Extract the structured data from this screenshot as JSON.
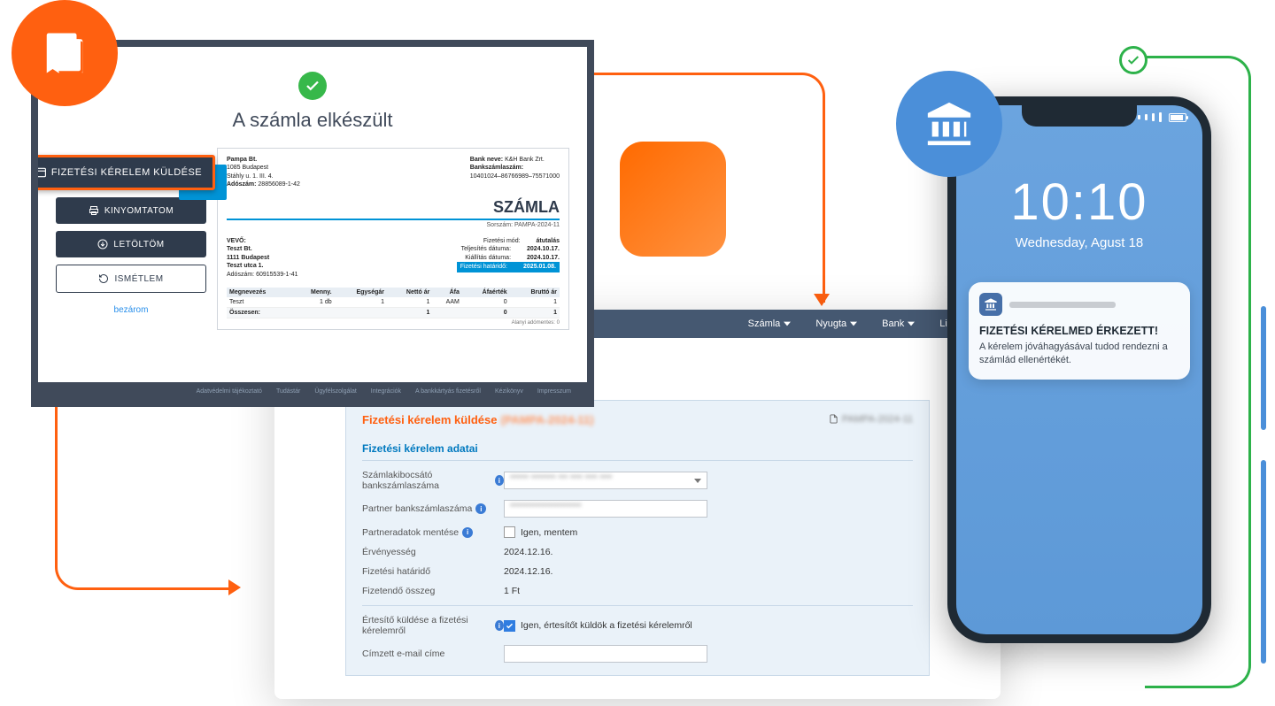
{
  "panel1": {
    "title": "A számla elkészült",
    "buttons": {
      "send_request": "FIZETÉSI KÉRELEM KÜLDÉSE",
      "print": "KINYOMTATOM",
      "download": "LETÖLTÖM",
      "repeat": "ISMÉTLEM"
    },
    "close": "bezárom",
    "invoice": {
      "seller": {
        "name": "Pampa Bt.",
        "line1": "1085 Budapest",
        "line2": "Stáhly u. 1. III. 4.",
        "tax_label": "Adószám:",
        "tax": "28856089-1-42"
      },
      "bank": {
        "name_label": "Bank neve:",
        "name": "K&H Bank Zrt.",
        "acct_label": "Bankszámlaszám:",
        "acct": "10401024–86766989–75571000"
      },
      "title": "SZÁMLA",
      "serial_label": "Sorszám:",
      "serial": "PAMPA-2024-11",
      "buyer_label": "VEVŐ:",
      "buyer": {
        "name": "Teszt Bt.",
        "line1": "1111 Budapest",
        "line2": "Teszt utca 1.",
        "tax_label": "Adószám:",
        "tax": "60915539-1-41"
      },
      "meta": {
        "pay_mode_label": "Fizetési mód:",
        "pay_mode": "átutalás",
        "fulfil_label": "Teljesítés dátuma:",
        "fulfil": "2024.10.17.",
        "issue_label": "Kiállítás dátuma:",
        "issue": "2024.10.17.",
        "due_label": "Fizetési határidő:",
        "due": "2025.01.08."
      },
      "headers": [
        "Megnevezés",
        "Menny.",
        "Egységár",
        "Nettó ár",
        "Áfa",
        "Áfaérték",
        "Bruttó ár"
      ],
      "row": [
        "Teszt",
        "1 db",
        "1",
        "1",
        "AAM",
        "0",
        "1"
      ],
      "sum_label": "Összesen:",
      "sum": [
        "",
        "",
        "",
        "1",
        "",
        "0",
        "1"
      ],
      "alm_label": "Alanyi adómentes:",
      "alm_value": "0"
    },
    "footer": [
      "Adatvédelmi tájékoztató",
      "Tudástár",
      "Ügyfélszolgálat",
      "Integrációk",
      "A bankkártyás fizetésről",
      "Kézikönyv",
      "Impresszum"
    ]
  },
  "panel2": {
    "nav": [
      "Számla",
      "Nyugta",
      "Bank",
      "Listák"
    ],
    "heading": "Fizetési kérelem küldése",
    "heading_context": "(PAMPA-2024-11)",
    "file": "PAMPA-2024-11",
    "section": "Fizetési kérelem adatai",
    "rows": {
      "issuer_account": "Számlakibocsátó bankszámlaszáma",
      "partner_account": "Partner bankszámlaszáma",
      "save_partner": "Partneradatok mentése",
      "save_partner_opt": "Igen, mentem",
      "validity": "Érvényesség",
      "validity_val": "2024.12.16.",
      "deadline": "Fizetési határidő",
      "deadline_val": "2024.12.16.",
      "amount": "Fizetendő összeg",
      "amount_val": "1 Ft",
      "notify": "Értesítő küldése a fizetési kérelemről",
      "notify_opt": "Igen, értesítőt küldök a fizetési kérelemről",
      "recipient": "Címzett e-mail címe"
    }
  },
  "phone": {
    "time": "10:10",
    "date": "Wednesday, Agust 18",
    "notif_title": "FIZETÉSI KÉRELMED ÉRKEZETT!",
    "notif_body": "A kérelem jóváhagyásával tudod rendezni a számlád ellenértékét."
  }
}
